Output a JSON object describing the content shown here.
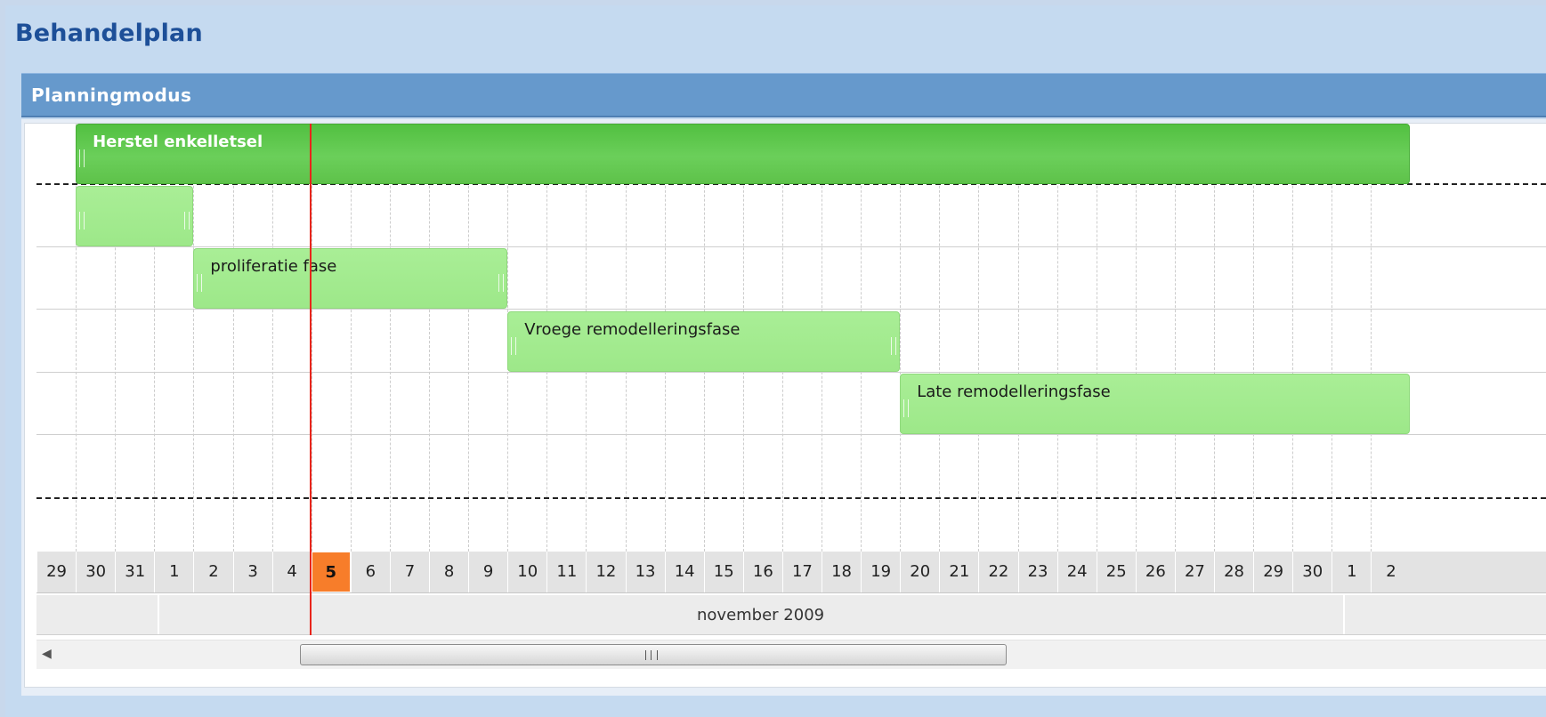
{
  "app": {
    "title": "Behandelplan"
  },
  "panel": {
    "title": "Planningmodus"
  },
  "timeline": {
    "days": [
      "29",
      "30",
      "31",
      "1",
      "2",
      "3",
      "4",
      "5",
      "6",
      "7",
      "8",
      "9",
      "10",
      "11",
      "12",
      "13",
      "14",
      "15",
      "16",
      "17",
      "18",
      "19",
      "20",
      "21",
      "22",
      "23",
      "24",
      "25",
      "26",
      "27",
      "28",
      "29",
      "30",
      "1",
      "2"
    ],
    "today_label": "5",
    "month_label": "november 2009"
  },
  "tasks": [
    {
      "label": "Herstel enkelletsel",
      "type": "parent",
      "start_day_index": 1,
      "end_day_index": 35
    },
    {
      "label": "",
      "type": "child",
      "start_day_index": 1,
      "end_day_index": 4
    },
    {
      "label": "proliferatie fase",
      "type": "child",
      "start_day_index": 4,
      "end_day_index": 12
    },
    {
      "label": "Vroege remodelleringsfase",
      "type": "child",
      "start_day_index": 12,
      "end_day_index": 22
    },
    {
      "label": "Late remodelleringsfase",
      "type": "child",
      "start_day_index": 22,
      "end_day_index": 35
    }
  ],
  "colors": {
    "title": "#1d4f98",
    "header": "#6699cc",
    "parent_bar": "#5ec24a",
    "child_bar": "#a9ee96",
    "today_highlight": "#f77d2a",
    "today_line": "#e8251b"
  },
  "icons": {
    "scroll_left": "left-arrow-icon",
    "scroll_thumb": "grip-icon"
  }
}
